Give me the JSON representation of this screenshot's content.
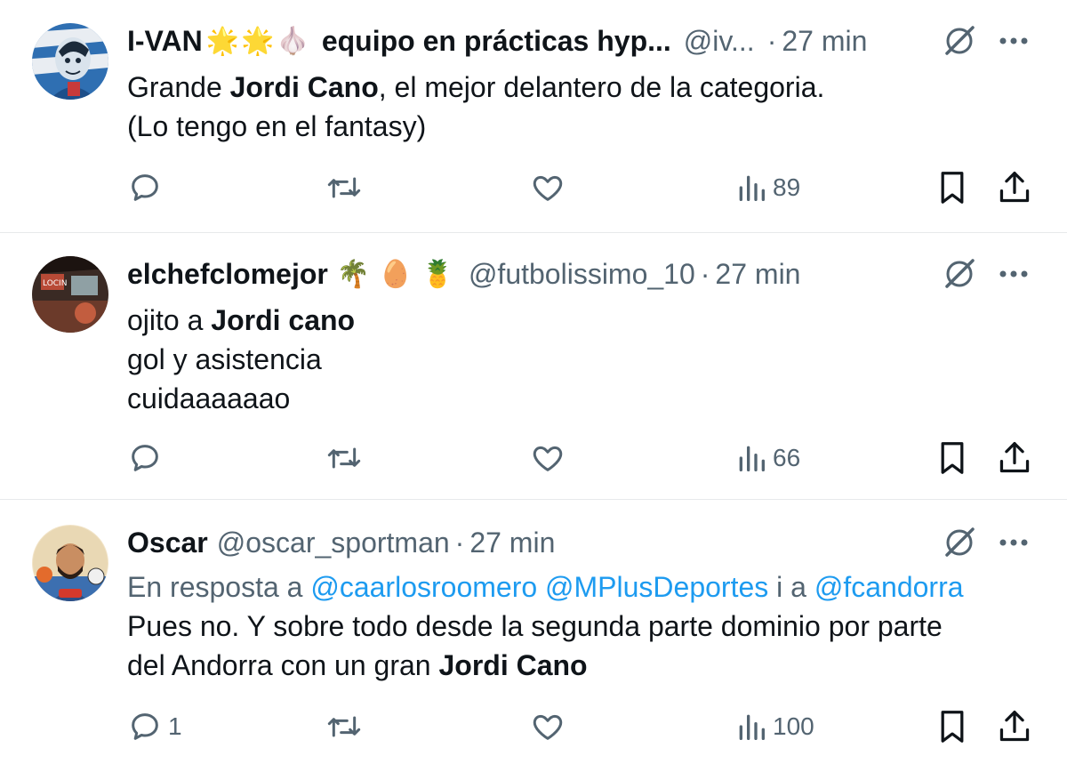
{
  "tweets": [
    {
      "name": "I-VAN",
      "badges": [
        "🌟",
        "🌟",
        "🧄"
      ],
      "affiliation": "equipo en prácticas hyp...",
      "handle": "@iv...",
      "time": "27 min",
      "reply_to": null,
      "lines": [
        [
          {
            "t": "Grande "
          },
          {
            "t": "Jordi Cano",
            "b": true
          },
          {
            "t": ", el mejor delantero de la categoria."
          }
        ],
        [
          {
            "t": "(Lo tengo en el fantasy)"
          }
        ]
      ],
      "stats": {
        "replies": "",
        "views": "89"
      }
    },
    {
      "name": "elchefclomejor",
      "badges": [
        "🌴",
        "🥚",
        "🍍"
      ],
      "affiliation": "",
      "handle": "@futbolissimo_10",
      "time": "27 min",
      "reply_to": null,
      "lines": [
        [
          {
            "t": "ojito a "
          },
          {
            "t": "Jordi cano",
            "b": true
          }
        ],
        [
          {
            "t": "gol y asistencia"
          }
        ],
        [
          {
            "t": "cuidaaaaaao"
          }
        ]
      ],
      "stats": {
        "replies": "",
        "views": "66"
      }
    },
    {
      "name": "Oscar",
      "badges": [],
      "affiliation": "",
      "handle": "@oscar_sportman",
      "time": "27 min",
      "reply_to": {
        "prefix": "En resposta a",
        "mentions": [
          "@caarlosroomero",
          "@MPlusDeportes"
        ],
        "joiner": "i a",
        "last": "@fcandorra"
      },
      "lines": [
        [
          {
            "t": "Pues no. Y sobre todo desde la segunda parte dominio por parte"
          }
        ],
        [
          {
            "t": "del Andorra con un gran "
          },
          {
            "t": "Jordi Cano",
            "b": true
          }
        ]
      ],
      "stats": {
        "replies": "1",
        "views": "100"
      }
    }
  ],
  "colors": {
    "text": "#0f1419",
    "secondary": "#536471",
    "link": "#1d9bf0",
    "divider": "#e7e9eb"
  },
  "icons": {
    "reply": "reply-icon",
    "retweet": "retweet-icon",
    "like": "heart-icon",
    "views": "views-icon",
    "bookmark": "bookmark-icon",
    "share": "share-icon",
    "grok": "grok-icon",
    "more": "more-icon"
  }
}
